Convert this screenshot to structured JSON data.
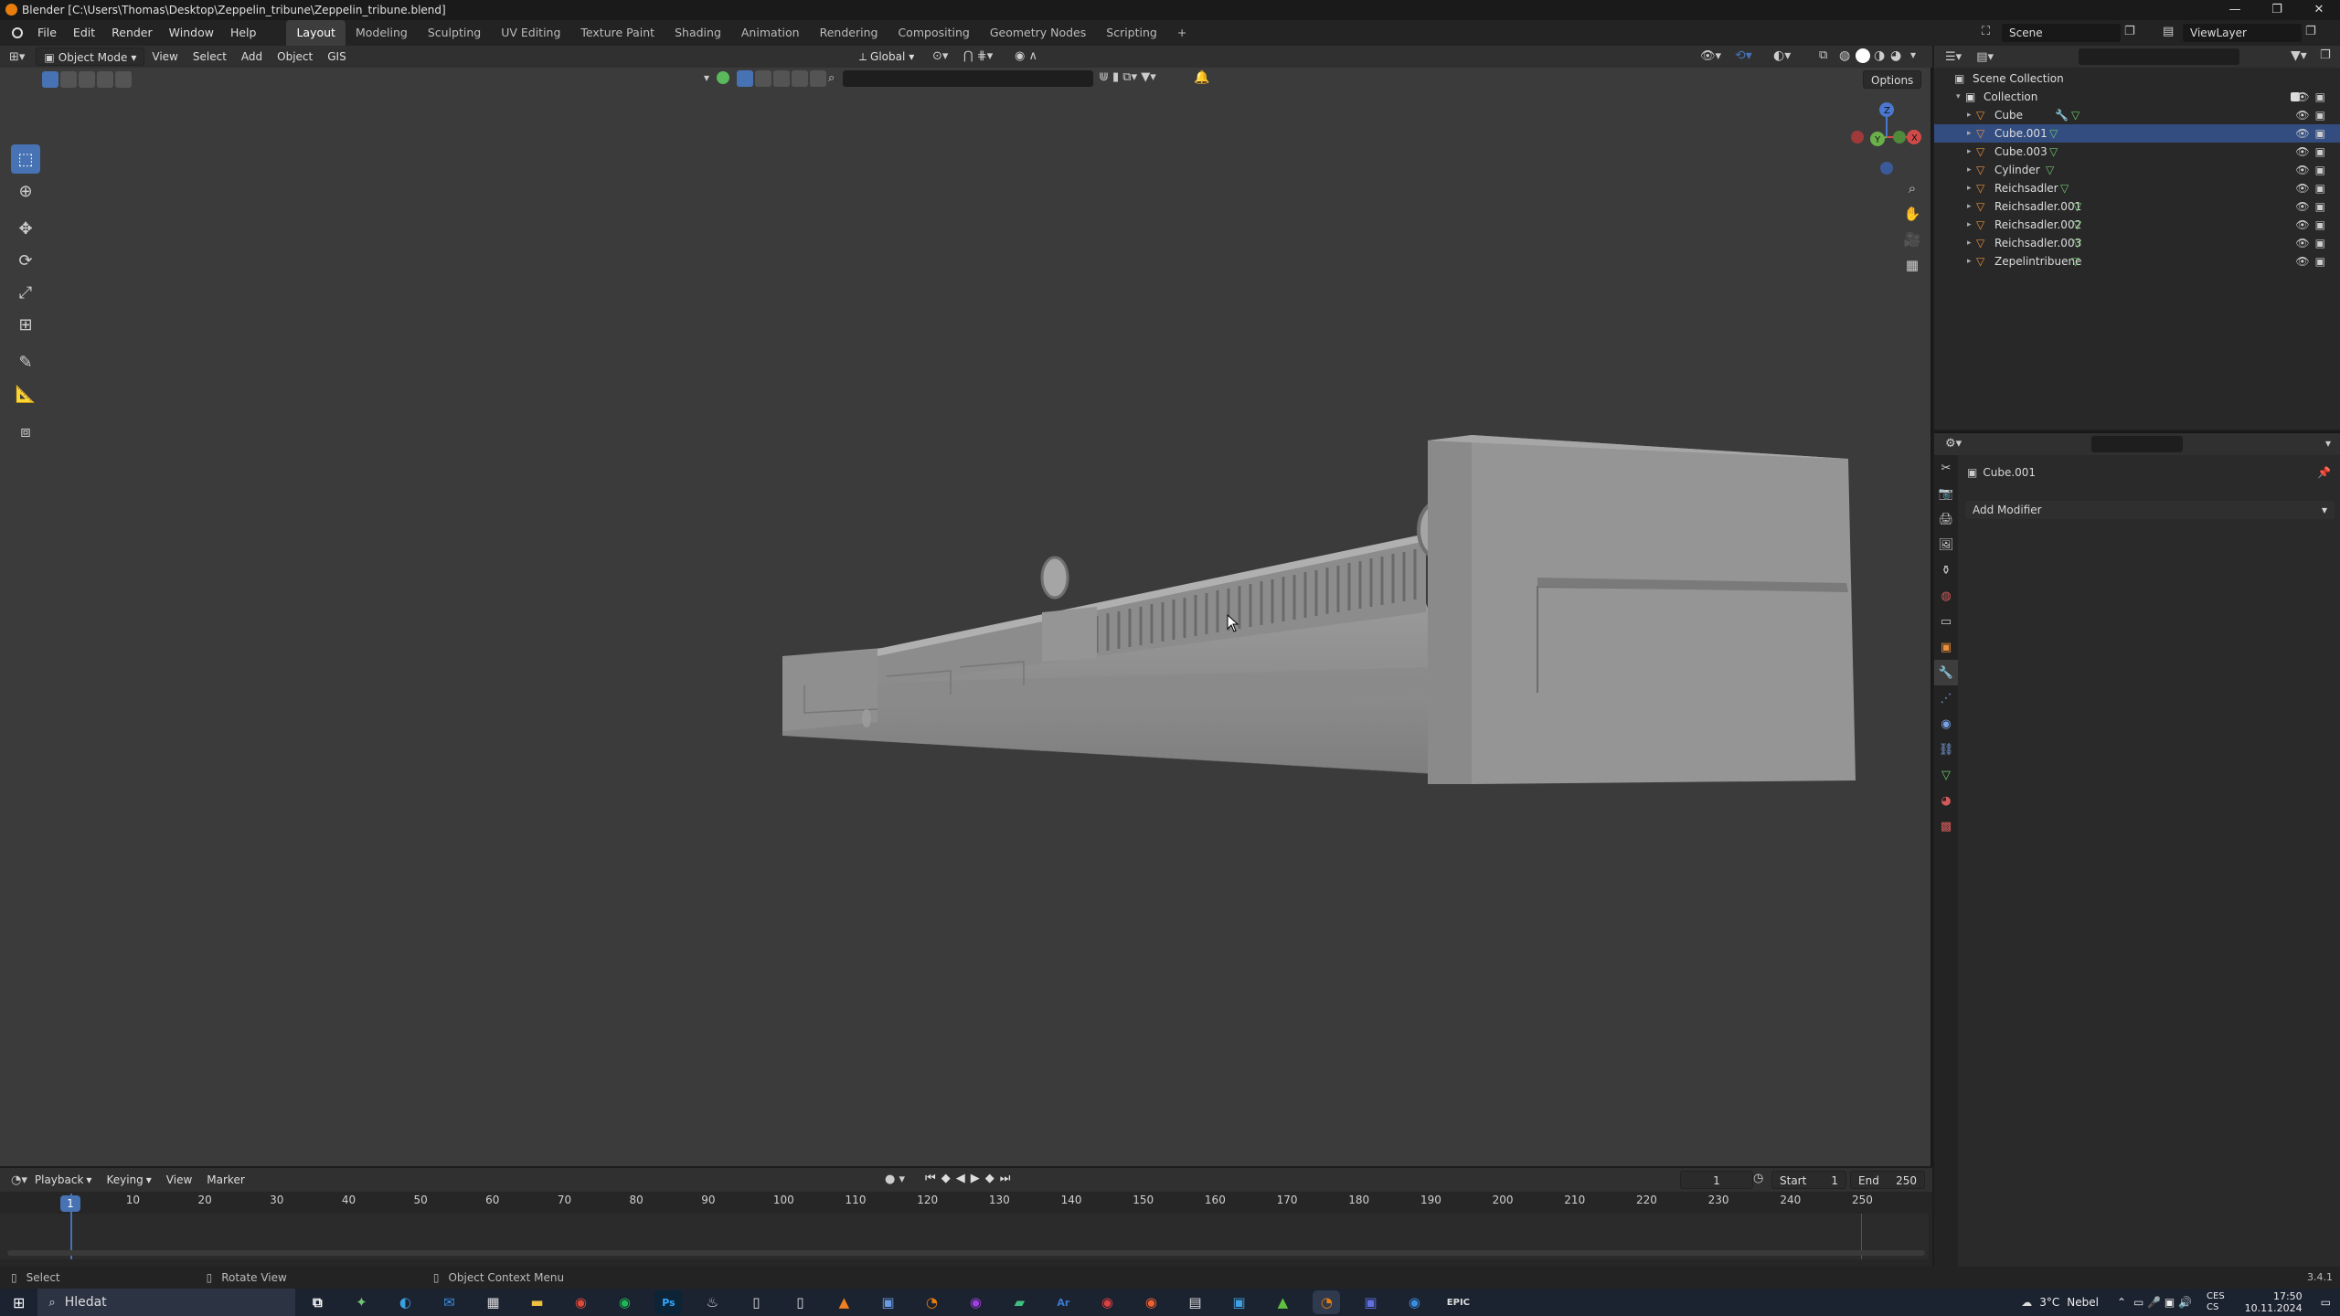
{
  "window": {
    "title": "Blender [C:\\Users\\Thomas\\Desktop\\Zeppelin_tribune\\Zeppelin_tribune.blend]",
    "controls": [
      "—",
      "❐",
      "✕"
    ]
  },
  "menu": [
    "File",
    "Edit",
    "Render",
    "Window",
    "Help"
  ],
  "workspaces": [
    "Layout",
    "Modeling",
    "Sculpting",
    "UV Editing",
    "Texture Paint",
    "Shading",
    "Animation",
    "Rendering",
    "Compositing",
    "Geometry Nodes",
    "Scripting",
    "+"
  ],
  "active_workspace": "Layout",
  "scene": {
    "name": "Scene",
    "view_layer": "ViewLayer"
  },
  "viewport": {
    "mode": "Object Mode",
    "menus": [
      "View",
      "Select",
      "Add",
      "Object",
      "GIS"
    ],
    "transform_orientation": "Global",
    "options_label": "Options"
  },
  "gizmo": {
    "x": "X",
    "y": "Y",
    "z": "Z"
  },
  "timeline": {
    "menus": [
      "Playback",
      "Keying",
      "View",
      "Marker"
    ],
    "current_frame": "1",
    "start_label": "Start",
    "start": "1",
    "end_label": "End",
    "end": "250",
    "ticks": [
      "1",
      "10",
      "20",
      "30",
      "40",
      "50",
      "60",
      "70",
      "80",
      "90",
      "100",
      "110",
      "120",
      "130",
      "140",
      "150",
      "160",
      "170",
      "180",
      "190",
      "200",
      "210",
      "220",
      "230",
      "240",
      "250"
    ]
  },
  "status": {
    "select": "Select",
    "rotate": "Rotate View",
    "context": "Object Context Menu",
    "version": "3.4.1"
  },
  "outliner": {
    "root": "Scene Collection",
    "collection": "Collection",
    "items": [
      "Cube",
      "Cube.001",
      "Cube.003",
      "Cylinder",
      "Reichsadler",
      "Reichsadler.001",
      "Reichsadler.002",
      "Reichsadler.003",
      "Zepelintribuene"
    ]
  },
  "properties": {
    "object_name": "Cube.001",
    "add_modifier": "Add Modifier"
  },
  "taskbar": {
    "search_placeholder": "Hledat",
    "weather_temp": "3°C",
    "weather_text": "Nebel",
    "lang_top": "CES",
    "lang_bottom": "CS",
    "time": "17:50",
    "date": "10.11.2024"
  }
}
